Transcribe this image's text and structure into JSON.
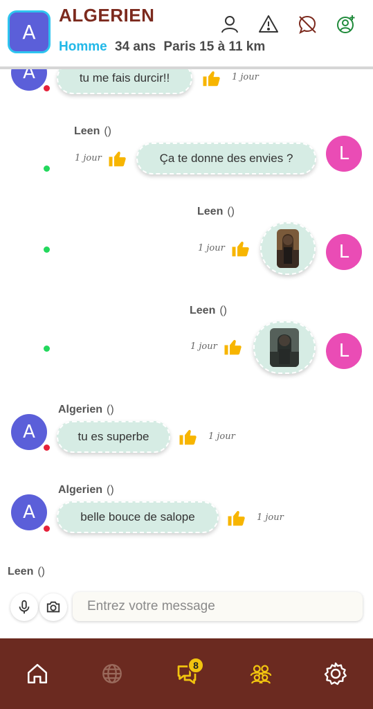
{
  "header": {
    "avatar_letter": "A",
    "name": "ALGERIEN",
    "gender": "Homme",
    "age": "34 ans",
    "location": "Paris 15 à 11 km",
    "icons": [
      "user-icon",
      "warning-icon",
      "block-icon",
      "add-friend-icon"
    ]
  },
  "messages": [
    {
      "sender": "",
      "text": "tu me fais durcir!!",
      "time": "1 jour",
      "avatar": "A",
      "status": "offline"
    },
    {
      "sender": "Leen",
      "paren": "()",
      "text": "Ça te donne des envies ?",
      "time": "1 jour",
      "avatar": "L",
      "status": "online"
    },
    {
      "sender": "Leen",
      "paren": "()",
      "image": "photo",
      "time": "1 jour",
      "avatar": "L",
      "status": "online"
    },
    {
      "sender": "Leen",
      "paren": "()",
      "image": "photo",
      "time": "1 jour",
      "avatar": "L",
      "status": "online"
    },
    {
      "sender": "Algerien",
      "paren": "()",
      "text": "tu es superbe",
      "time": "1 jour",
      "avatar": "A",
      "status": "offline"
    },
    {
      "sender": "Algerien",
      "paren": "()",
      "text": "belle bouce de salope",
      "time": "1 jour",
      "avatar": "A",
      "status": "offline"
    },
    {
      "sender": "Leen",
      "paren": "()"
    }
  ],
  "input": {
    "placeholder": "Entrez votre message",
    "value": ""
  },
  "nav": {
    "items": [
      "home-icon",
      "globe-icon",
      "chat-icon",
      "group-icon",
      "settings-icon"
    ],
    "chat_badge": "8",
    "active": "chat"
  },
  "colors": {
    "brand": "#6b2a20",
    "accent": "#22b8e8",
    "bubble": "#d6ece4",
    "online": "#23d85d",
    "offline": "#e5213a"
  }
}
